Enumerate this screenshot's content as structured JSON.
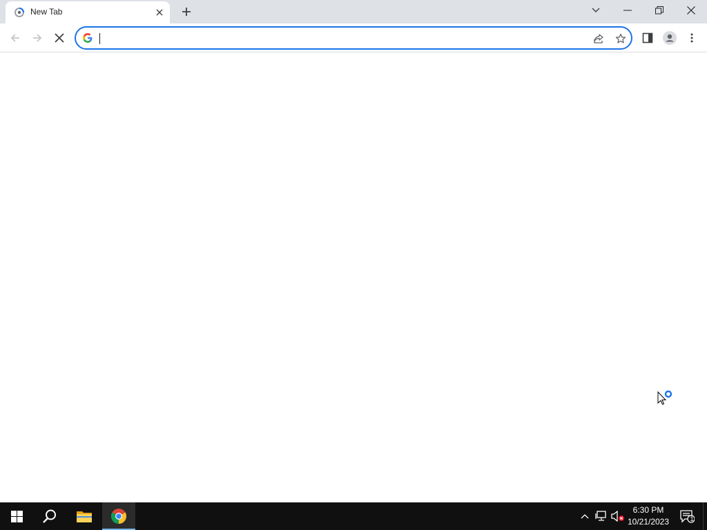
{
  "browser": {
    "tab": {
      "title": "New Tab",
      "favicon": "loading-spinner-icon"
    },
    "new_tab_icon": "plus-icon",
    "window_controls": [
      "tab-search-icon",
      "minimize-icon",
      "restore-icon",
      "close-icon"
    ],
    "toolbar": {
      "nav_icons": [
        "back-arrow-icon",
        "forward-arrow-icon",
        "stop-loading-icon"
      ],
      "omnibox": {
        "value": "",
        "placeholder": "",
        "left_icon": "google-g-icon",
        "right_icons": [
          "share-icon",
          "bookmark-star-icon"
        ]
      },
      "right_icons": [
        "side-panel-icon",
        "profile-icon",
        "menu-kebab-icon"
      ]
    },
    "accent_color": "#1a73e8"
  },
  "taskbar": {
    "apps": [
      "windows-start-icon",
      "search-icon",
      "file-explorer-icon",
      "chrome-icon"
    ],
    "active_app": "chrome-icon",
    "tray_icons": [
      "chevron-up-icon",
      "network-icon",
      "speaker-muted-icon"
    ],
    "clock": {
      "time": "6:30 PM",
      "date": "10/21/2023"
    },
    "notifications": {
      "icon": "action-center-icon",
      "count": "1"
    }
  }
}
